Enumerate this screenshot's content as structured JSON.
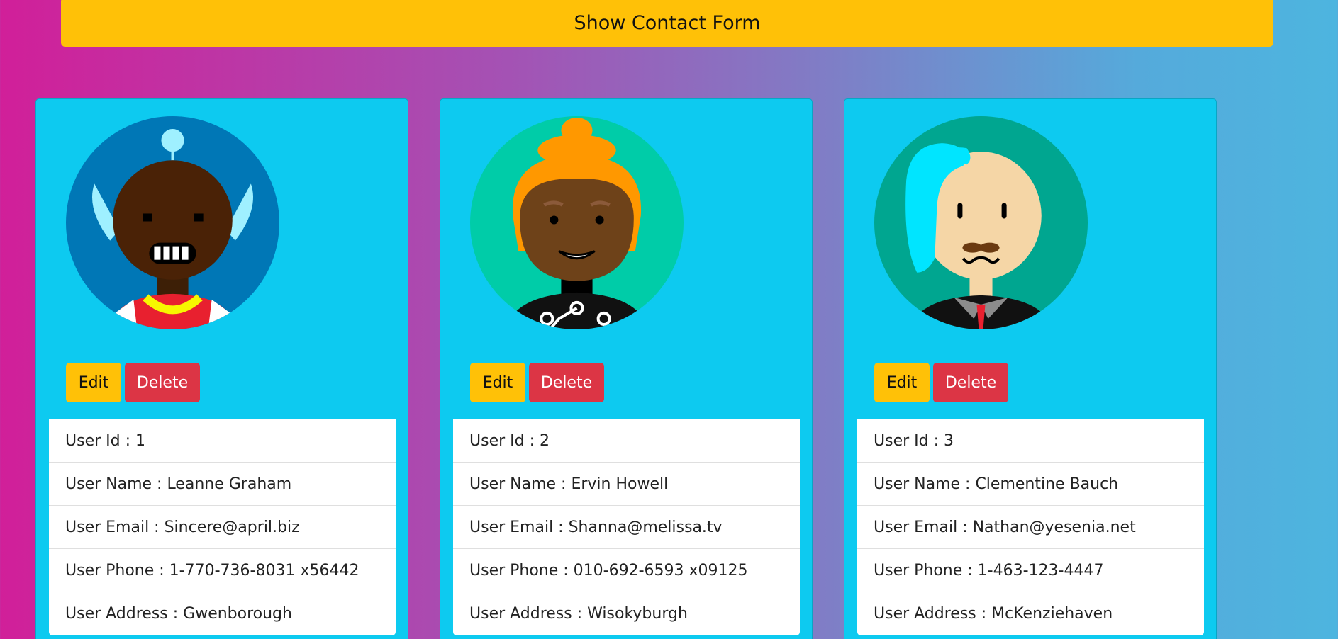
{
  "header": {
    "show_form_label": "Show Contact Form"
  },
  "actions": {
    "edit_label": "Edit",
    "delete_label": "Delete"
  },
  "colors": {
    "card_bg": "#0dcaf0",
    "warning": "#ffc107",
    "danger": "#dc3545"
  },
  "users": [
    {
      "avatar": "avatar-robot-smile-icon",
      "id": "User Id : 1",
      "name": "User Name : Leanne Graham",
      "email": "User Email : Sincere@april.biz",
      "phone": "User Phone : 1-770-736-8031 x56442",
      "address": "User Address : Gwenborough"
    },
    {
      "avatar": "avatar-orange-hair-icon",
      "id": "User Id : 2",
      "name": "User Name : Ervin Howell",
      "email": "User Email : Shanna@melissa.tv",
      "phone": "User Phone : 010-692-6593 x09125",
      "address": "User Address : Wisokyburgh"
    },
    {
      "avatar": "avatar-mustache-icon",
      "id": "User Id : 3",
      "name": "User Name : Clementine Bauch",
      "email": "User Email : Nathan@yesenia.net",
      "phone": "User Phone : 1-463-123-4447",
      "address": "User Address : McKenziehaven"
    }
  ]
}
